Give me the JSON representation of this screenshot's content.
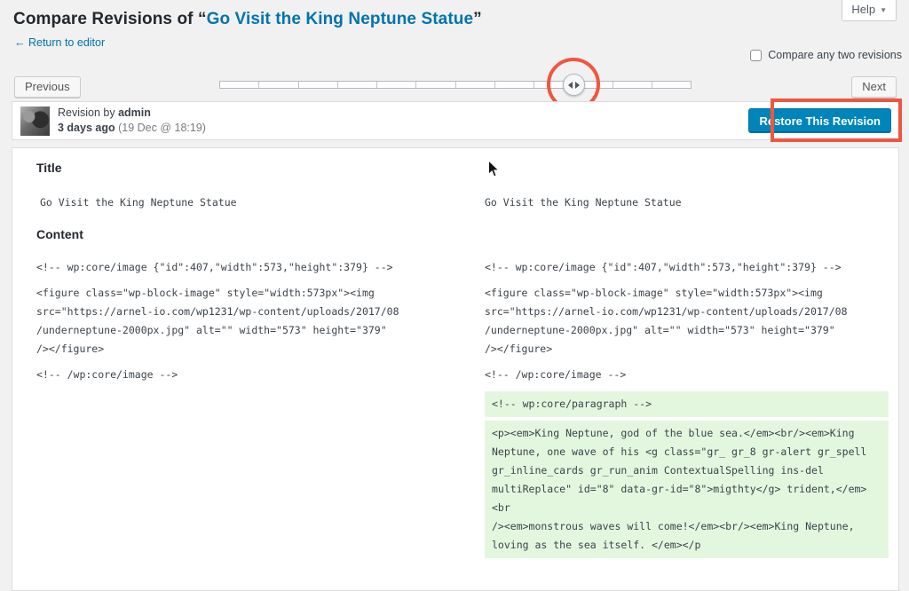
{
  "header": {
    "title_prefix": "Compare Revisions of ",
    "quote_open": "“",
    "post_title": "Go Visit the King Neptune Statue",
    "quote_close": "”",
    "return_link": "← Return to editor",
    "help_label": "Help",
    "help_arrow": "▼",
    "compare_checkbox_label": "Compare any two revisions",
    "compare_checkbox_checked": false
  },
  "controls": {
    "previous_label": "Previous",
    "next_label": "Next",
    "slider_segments": 12,
    "handle_tick_index": 9
  },
  "revision_bar": {
    "byline_prefix": "Revision by ",
    "author": "admin",
    "time_ago": "3 days ago",
    "timestamp": "(19 Dec @ 18:19)",
    "restore_label": "Restore This Revision"
  },
  "diff": {
    "title_heading": "Title",
    "content_heading": "Content",
    "left_title": "Go Visit the King Neptune Statue",
    "right_title": "Go Visit the King Neptune Statue",
    "left_blocks": [
      "<!-- wp:core/image {\"id\":407,\"width\":573,\"height\":379} -->",
      "<figure class=\"wp-block-image\" style=\"width:573px\"><img\nsrc=\"https://arnel-io.com/wp1231/wp-content/uploads/2017/08\n/underneptune-2000px.jpg\" alt=\"\" width=\"573\" height=\"379\"\n/></figure>",
      "<!-- /wp:core/image -->"
    ],
    "right_blocks": [
      "<!-- wp:core/image {\"id\":407,\"width\":573,\"height\":379} -->",
      "<figure class=\"wp-block-image\" style=\"width:573px\"><img\nsrc=\"https://arnel-io.com/wp1231/wp-content/uploads/2017/08\n/underneptune-2000px.jpg\" alt=\"\" width=\"573\" height=\"379\"\n/></figure>",
      "<!-- /wp:core/image -->"
    ],
    "right_added_blocks": [
      "<!-- wp:core/paragraph -->",
      "<p><em>King Neptune, god of the blue sea.</em><br/><em>King\nNeptune, one wave of his <g class=\"gr_ gr_8 gr-alert gr_spell\ngr_inline_cards gr_run_anim ContextualSpelling ins-del\nmultiReplace\" id=\"8\" data-gr-id=\"8\">migthty</g> trident,</em><br\n/><em>monstrous waves will come!</em><br/><em>King Neptune,\nloving as the sea itself. </em></p"
    ]
  },
  "colors": {
    "annotation": "#f0563f",
    "link": "#0073aa",
    "primary_button": "#0085ba",
    "added_background": "#e3f7df"
  }
}
